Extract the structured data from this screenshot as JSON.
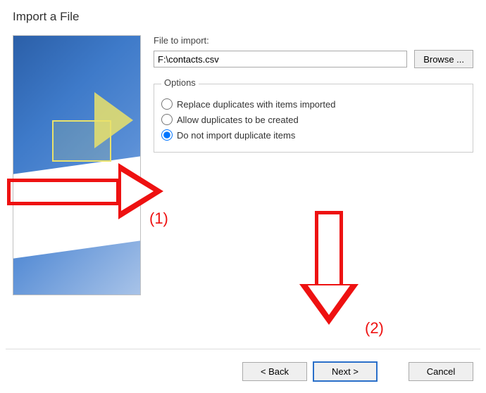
{
  "dialog": {
    "title": "Import a File"
  },
  "file": {
    "label": "File to import:",
    "value": "F:\\contacts.csv",
    "browse": "Browse ..."
  },
  "options": {
    "legend": "Options",
    "radios": [
      {
        "label": "Replace duplicates with items imported",
        "checked": false
      },
      {
        "label": "Allow duplicates to be created",
        "checked": false
      },
      {
        "label": "Do not import duplicate items",
        "checked": true
      }
    ]
  },
  "buttons": {
    "back": "< Back",
    "next": "Next >",
    "cancel": "Cancel"
  },
  "annotations": {
    "label1": "(1)",
    "label2": "(2)"
  }
}
